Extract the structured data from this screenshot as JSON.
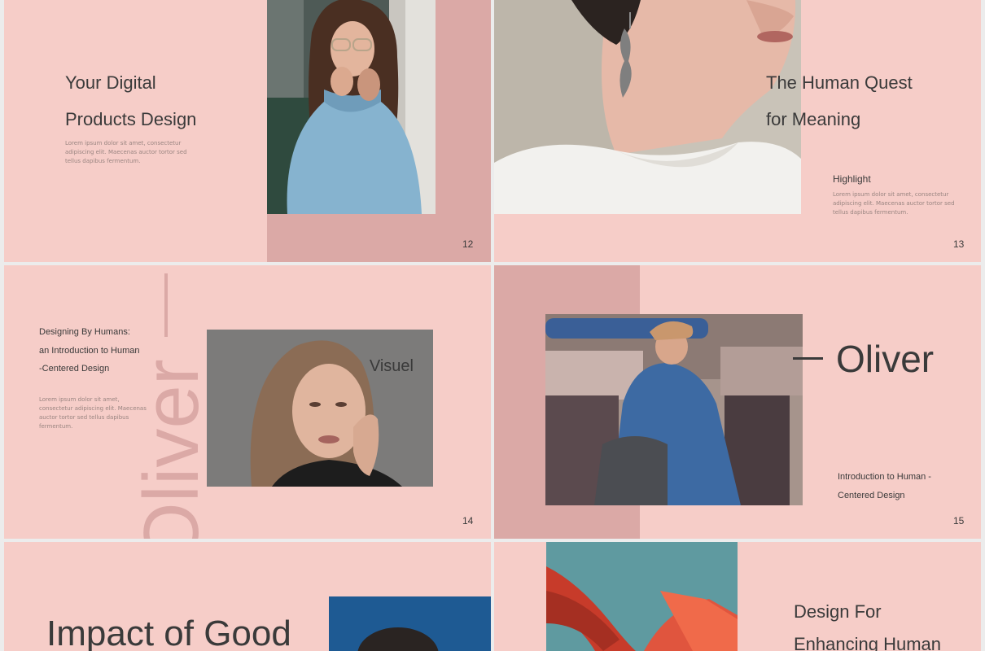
{
  "slides": [
    {
      "id": "12",
      "title_line1": "Your Digital",
      "title_line2": "Products Design",
      "body": "Lorem ipsum dolor sit amet, consectetur adipiscing elit. Maecenas auctor tortor sed tellus dapibus fermentum.",
      "page": "12",
      "photo": "woman-glasses-blue-sweater-photo"
    },
    {
      "id": "13",
      "title_line1": "The Human Quest",
      "title_line2": "for Meaning",
      "heading": "Highlight",
      "body": "Lorem ipsum dolor sit amet, consectetur adipiscing elit. Maecenas auctor tortor sed tellus dapibus fermentum.",
      "page": "13",
      "photo": "woman-earring-profile-photo"
    },
    {
      "id": "14",
      "subtitle_line1": "Designing By Humans:",
      "subtitle_line2": "an Introduction to Human",
      "subtitle_line3": "-Centered Design",
      "body": "Lorem ipsum dolor sit amet, consectetur adipiscing elit. Maecenas auctor tortor sed tellus dapibus fermentum.",
      "vertical_word": "Oliver",
      "photo_caption": "Visuel",
      "page": "14",
      "photo": "woman-portrait-photo"
    },
    {
      "id": "15",
      "name": "Oliver",
      "subtitle_line1": "Introduction to Human -",
      "subtitle_line2": "Centered Design",
      "page": "15",
      "photo": "person-denim-jacket-photo"
    },
    {
      "id": "16",
      "title": "Impact of Good",
      "photo": "person-blue-background-photo"
    },
    {
      "id": "17",
      "title_line1": "Design For",
      "title_line2": "Enhancing Human",
      "photo": "red-sculpture-sky-photo"
    }
  ],
  "colors": {
    "slide_bg": "#f6cdc8",
    "accent": "#dba9a6",
    "text": "#3a3a3a",
    "gap": "#ececec"
  }
}
